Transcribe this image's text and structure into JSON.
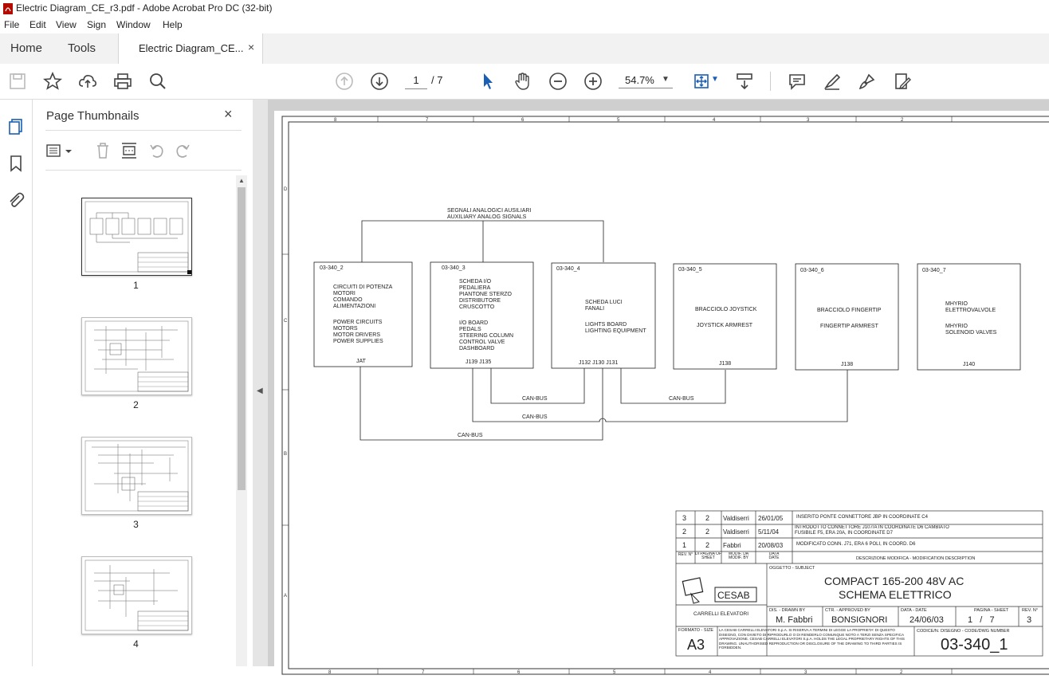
{
  "window": {
    "title": "Electric Diagram_CE_r3.pdf - Adobe Acrobat Pro DC (32-bit)"
  },
  "menu": [
    "File",
    "Edit",
    "View",
    "Sign",
    "Window",
    "Help"
  ],
  "tabs": {
    "home": "Home",
    "tools": "Tools",
    "document": "Electric Diagram_CE...",
    "close": "×"
  },
  "toolbar": {
    "page_current": "1",
    "page_total": "/ 7",
    "zoom": "54.7%"
  },
  "thumbnails": {
    "title": "Page Thumbnails",
    "close": "×",
    "pages": [
      "1",
      "2",
      "3",
      "4"
    ]
  },
  "diagram": {
    "bus_top_label_1": "SEGNALI ANALOGICI AUSILIARI",
    "bus_top_label_2": "AUXILIARY ANALOG SIGNALS",
    "boxes": [
      {
        "id": "03-340_2",
        "lines": [
          "CIRCUITI DI POTENZA",
          "MOTORI",
          "COMANDO",
          "ALIMENTAZIONI",
          "",
          "POWER CIRCUITS",
          "MOTORS",
          "MOTOR DRIVERS",
          "POWER SUPPLIES"
        ],
        "connector": "JAT"
      },
      {
        "id": "03-340_3",
        "lines": [
          "SCHEDA I/O",
          "PEDALIERA",
          "PIANTONE STERZO",
          "DISTRIBUTORE",
          "CRUSCOTTO",
          "",
          "I/O BOARD",
          "PEDALS",
          "STEERING COLUMN",
          "CONTROL VALVE",
          "DASHBOARD"
        ],
        "connector": "J139   J135"
      },
      {
        "id": "03-340_4",
        "lines": [
          "SCHEDA LUCI",
          "FANALI",
          "",
          "LIGHTS BOARD",
          "LIGHTING EQUIPMENT"
        ],
        "connector": "J132   J130   J131"
      },
      {
        "id": "03-340_5",
        "lines": [
          "BRACCIOLO JOYSTICK",
          "",
          "JOYSTICK ARMREST"
        ],
        "connector": "J138"
      },
      {
        "id": "03-340_6",
        "lines": [
          "BRACCIOLO FINGERTIP",
          "",
          "FINGERTIP ARMREST"
        ],
        "connector": "J138"
      },
      {
        "id": "03-340_7",
        "lines": [
          "MHYRIO",
          "ELETTROVALVOLE",
          "",
          "MHYRIO",
          "SOLENOID VALVES"
        ],
        "connector": "J140"
      }
    ],
    "canbus": "CAN-BUS",
    "border_cols": [
      "8",
      "7",
      "6",
      "5",
      "4",
      "3",
      "2"
    ],
    "border_rows": [
      "D",
      "C",
      "B",
      "A"
    ]
  },
  "titleblock": {
    "revisions": [
      {
        "rev": "3",
        "sheet": "2",
        "by": "Valdiserri",
        "date": "26/01/05",
        "desc": "INSERITO PONTE CONNETTORE JBP IN COORDINATE C4"
      },
      {
        "rev": "2",
        "sheet": "2",
        "by": "Valdiserri",
        "date": "5/11/04",
        "desc": "INTRODOTTO CONNETTORE J107/A IN COORDINATE D6 CAMBIATO FUSIBILE F5, ERA 20A, IN COORDINATE D7"
      },
      {
        "rev": "1",
        "sheet": "2",
        "by": "Fabbri",
        "date": "20/08/03",
        "desc": "MODIFICATO CONN. J71, ERA 6 POLI, IN COORD. D6"
      }
    ],
    "hdr_rev": "REV. N°",
    "hdr_sheet": "DI PAGINA OF SHEET",
    "hdr_by": "MODIF. DA MODIF. BY",
    "hdr_date": "DATA DATE",
    "hdr_desc": "DESCRIZIONE MODIFICA - MODIFICATION DESCRIPTION",
    "subject_label": "OGGETTO - SUBJECT",
    "subject_1": "COMPACT 165-200 48V AC",
    "subject_2": "SCHEMA ELETTRICO",
    "logo": "CESAB",
    "logo_sub": "CARRELLI ELEVATORI",
    "drawn_label": "DIS. - DRAWN BY",
    "drawn": "M. Fabbri",
    "approved_label": "CTR. - APPROVED BY",
    "approved": "BONSIGNORI",
    "date_label": "DATA - DATE",
    "date": "24/06/03",
    "sheet_label": "PAGINA - SHEET",
    "sheet": "1   /   7",
    "rev_label": "REV. N°",
    "rev": "3",
    "size_label": "FORMATO - SIZE",
    "size": "A3",
    "legal": "LA CESAB CARRELLI ELEVATORI S.p.A. SI RISERVA A TERMINI DI LEGGE LA PROPRIETA' DI QUESTO DISEGNO, CON DIVIETO DI RIPRODURLO O DI RENDERLO COMUNQUE NOTO A TERZI SENZA SPECIFICA APPROVAZIONE. CESAB CARRELLI ELEVATORI S.p.A. HOLDS THE LEGAL PROPRIETARY RIGHTS OF THIS DRAWING. UNAUTHORISED REPRODUCTION OR DISCLOSURE OF THE DRAWING TO THIRD PARTIES IS FORBIDDEN.",
    "code_label": "CODICE/N. DISEGNO - CODE/DWG NUMBER",
    "code": "03-340_1"
  }
}
